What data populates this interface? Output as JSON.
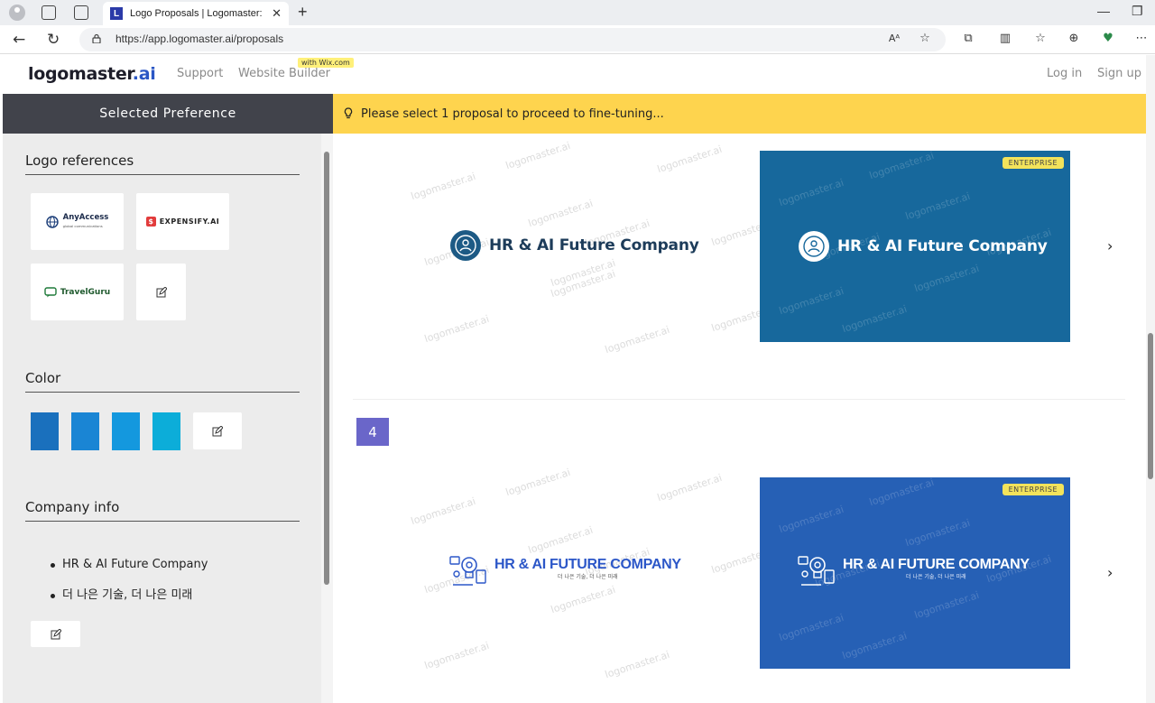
{
  "browser": {
    "tab_favicon": "L",
    "tab_title": "Logo Proposals | Logomaster: Or",
    "url": "https://app.logomaster.ai/proposals"
  },
  "header": {
    "logo_main": "logomaster",
    "logo_ai": ".ai",
    "nav_support": "Support",
    "nav_website_builder": "Website Builder",
    "wix_badge": "with Wix.com",
    "login": "Log in",
    "signup": "Sign up"
  },
  "sidebar": {
    "title": "Selected Preference",
    "logo_refs_title": "Logo references",
    "refs": [
      {
        "name": "AnyAccess",
        "sub": "global communications"
      },
      {
        "name": "EXPENSIFY.AI"
      },
      {
        "name": "TravelGuru"
      }
    ],
    "color_title": "Color",
    "colors": [
      "#1a70bd",
      "#1a85d4",
      "#1498de",
      "#0cadd9"
    ],
    "company_title": "Company info",
    "company_items": [
      "HR & AI Future Company",
      "더 나은 기술, 더 나은 미래"
    ]
  },
  "banner": {
    "message": "Please select 1 proposal to proceed to fine-tuning..."
  },
  "proposals": [
    {
      "company": "HR & AI Future Company",
      "badge": "ENTERPRISE",
      "card_color": "#17689c"
    },
    {
      "number": "4",
      "company": "HR & AI FUTURE COMPANY",
      "tagline": "더 나은 기술, 더 나은 미래",
      "badge": "ENTERPRISE",
      "card_color": "#2660b5"
    }
  ],
  "watermark": "logomaster.ai",
  "icons": [
    "profile-icon",
    "tabs-icon",
    "sidebar-icon",
    "back-icon",
    "refresh-icon",
    "lock-icon",
    "read-aloud-icon",
    "star-icon",
    "extensions-icon",
    "split-icon",
    "favorites-icon",
    "collections-icon",
    "heart-icon",
    "more-icon",
    "bulb-icon",
    "pencil-icon",
    "chevron-right-icon"
  ]
}
